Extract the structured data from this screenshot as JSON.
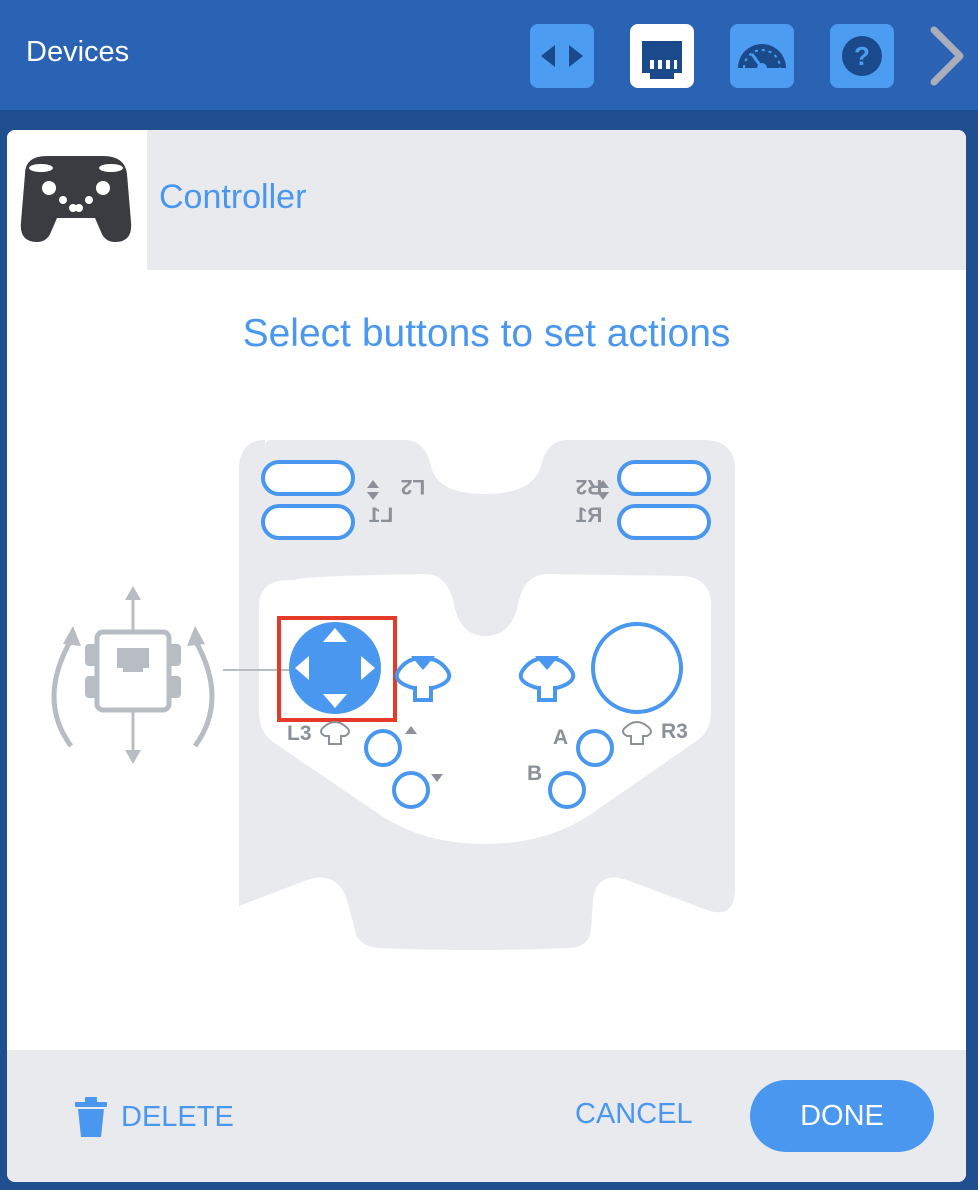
{
  "topbar": {
    "title": "Devices",
    "buttons": [
      {
        "name": "code-icon",
        "active": false
      },
      {
        "name": "port-icon",
        "active": true
      },
      {
        "name": "dashboard-icon",
        "active": false
      },
      {
        "name": "help-icon",
        "active": false,
        "label": "?"
      }
    ],
    "next_icon": "chevron-right-icon"
  },
  "device": {
    "name": "Controller",
    "icon": "gamepad-icon"
  },
  "instructions": "Select buttons to set actions",
  "controller": {
    "labels": {
      "l1": "L1",
      "l2": "L2",
      "r1": "R1",
      "r2": "R2",
      "l3": "L3",
      "r3": "R3",
      "a": "A",
      "b": "B"
    },
    "selected": "left-joystick",
    "action_icon": "drive-robot-icon"
  },
  "footer": {
    "delete_label": "DELETE",
    "cancel_label": "CANCEL",
    "done_label": "DONE"
  },
  "colors": {
    "topbar": "#2a63b4",
    "accent": "#4a97f0",
    "selection": "#e53a2a",
    "controller_body": "#e9eaed"
  }
}
